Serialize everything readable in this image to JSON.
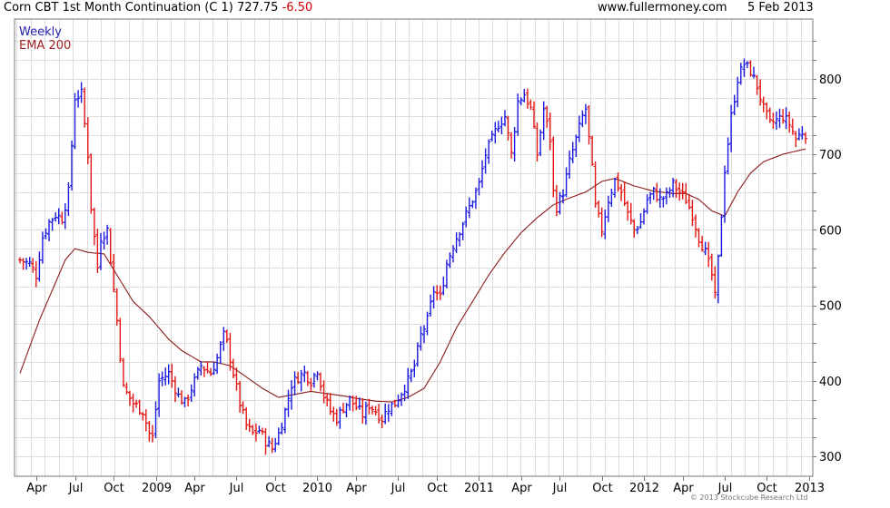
{
  "header": {
    "title": "Corn CBT 1st Month Continuation (C 1) 727.75",
    "change": "-6.50",
    "site": "www.fullermoney.com",
    "date": "5 Feb 2013"
  },
  "legend": {
    "weekly": "Weekly",
    "ema": "EMA 200"
  },
  "copyright": "© 2013 Stockcube Research Ltd",
  "colors": {
    "up": "#1a1adf",
    "down": "#e31414",
    "ema": "#8b1a1a",
    "grid": "#dddddd",
    "frame": "#777777"
  },
  "chart_data": {
    "type": "ohlc",
    "ylim": [
      290,
      860
    ],
    "y_ticks": [
      300,
      400,
      500,
      600,
      700,
      800
    ],
    "x_range": [
      0,
      243
    ],
    "x_ticks": [
      {
        "x": 5,
        "label": "Apr"
      },
      {
        "x": 17,
        "label": "Jul"
      },
      {
        "x": 29,
        "label": "Oct"
      },
      {
        "x": 42,
        "label": "2009"
      },
      {
        "x": 54,
        "label": "Apr"
      },
      {
        "x": 67,
        "label": "Jul"
      },
      {
        "x": 79,
        "label": "Oct"
      },
      {
        "x": 92,
        "label": "2010"
      },
      {
        "x": 104,
        "label": "Apr"
      },
      {
        "x": 117,
        "label": "Jul"
      },
      {
        "x": 129,
        "label": "Oct"
      },
      {
        "x": 142,
        "label": "2011"
      },
      {
        "x": 155,
        "label": "Apr"
      },
      {
        "x": 167,
        "label": "Jul"
      },
      {
        "x": 180,
        "label": "Oct"
      },
      {
        "x": 193,
        "label": "2012"
      },
      {
        "x": 205,
        "label": "Apr"
      },
      {
        "x": 218,
        "label": "Jul"
      },
      {
        "x": 231,
        "label": "Oct"
      },
      {
        "x": 244,
        "label": "2013"
      }
    ],
    "close_anchors": [
      [
        0,
        560
      ],
      [
        3,
        555
      ],
      [
        5,
        540
      ],
      [
        7,
        590
      ],
      [
        9,
        610
      ],
      [
        11,
        620
      ],
      [
        13,
        615
      ],
      [
        15,
        650
      ],
      [
        17,
        775
      ],
      [
        19,
        780
      ],
      [
        21,
        700
      ],
      [
        22,
        630
      ],
      [
        24,
        550
      ],
      [
        25,
        590
      ],
      [
        27,
        600
      ],
      [
        28,
        560
      ],
      [
        30,
        480
      ],
      [
        32,
        390
      ],
      [
        35,
        370
      ],
      [
        38,
        360
      ],
      [
        40,
        330
      ],
      [
        41,
        325
      ],
      [
        43,
        400
      ],
      [
        46,
        410
      ],
      [
        49,
        380
      ],
      [
        51,
        370
      ],
      [
        53,
        390
      ],
      [
        56,
        420
      ],
      [
        59,
        410
      ],
      [
        61,
        430
      ],
      [
        63,
        460
      ],
      [
        64,
        450
      ],
      [
        66,
        410
      ],
      [
        68,
        370
      ],
      [
        70,
        340
      ],
      [
        72,
        330
      ],
      [
        74,
        335
      ],
      [
        76,
        320
      ],
      [
        78,
        310
      ],
      [
        80,
        330
      ],
      [
        82,
        360
      ],
      [
        84,
        395
      ],
      [
        86,
        405
      ],
      [
        88,
        410
      ],
      [
        90,
        400
      ],
      [
        92,
        415
      ],
      [
        94,
        380
      ],
      [
        96,
        360
      ],
      [
        98,
        350
      ],
      [
        100,
        365
      ],
      [
        102,
        375
      ],
      [
        104,
        365
      ],
      [
        106,
        355
      ],
      [
        108,
        368
      ],
      [
        110,
        360
      ],
      [
        112,
        350
      ],
      [
        114,
        365
      ],
      [
        116,
        370
      ],
      [
        118,
        385
      ],
      [
        120,
        400
      ],
      [
        122,
        420
      ],
      [
        124,
        460
      ],
      [
        126,
        480
      ],
      [
        128,
        520
      ],
      [
        130,
        510
      ],
      [
        132,
        555
      ],
      [
        134,
        580
      ],
      [
        136,
        600
      ],
      [
        138,
        620
      ],
      [
        140,
        640
      ],
      [
        142,
        660
      ],
      [
        144,
        700
      ],
      [
        146,
        720
      ],
      [
        148,
        740
      ],
      [
        150,
        750
      ],
      [
        152,
        700
      ],
      [
        154,
        770
      ],
      [
        156,
        780
      ],
      [
        158,
        760
      ],
      [
        160,
        700
      ],
      [
        162,
        760
      ],
      [
        164,
        720
      ],
      [
        165,
        650
      ],
      [
        166,
        630
      ],
      [
        168,
        650
      ],
      [
        170,
        690
      ],
      [
        172,
        720
      ],
      [
        174,
        750
      ],
      [
        175,
        760
      ],
      [
        176,
        720
      ],
      [
        177,
        680
      ],
      [
        178,
        630
      ],
      [
        180,
        600
      ],
      [
        182,
        640
      ],
      [
        184,
        665
      ],
      [
        186,
        650
      ],
      [
        188,
        620
      ],
      [
        190,
        600
      ],
      [
        192,
        610
      ],
      [
        194,
        640
      ],
      [
        196,
        650
      ],
      [
        198,
        640
      ],
      [
        200,
        645
      ],
      [
        202,
        660
      ],
      [
        204,
        650
      ],
      [
        206,
        640
      ],
      [
        208,
        620
      ],
      [
        210,
        590
      ],
      [
        212,
        570
      ],
      [
        214,
        540
      ],
      [
        215,
        510
      ],
      [
        216,
        560
      ],
      [
        218,
        680
      ],
      [
        220,
        750
      ],
      [
        222,
        800
      ],
      [
        224,
        820
      ],
      [
        226,
        810
      ],
      [
        228,
        790
      ],
      [
        230,
        760
      ],
      [
        232,
        740
      ],
      [
        234,
        745
      ],
      [
        236,
        750
      ],
      [
        238,
        740
      ],
      [
        240,
        720
      ],
      [
        242,
        730
      ],
      [
        244,
        725
      ],
      [
        246,
        700
      ],
      [
        247,
        685
      ],
      [
        248,
        700
      ],
      [
        250,
        720
      ],
      [
        252,
        728
      ]
    ],
    "ema_anchors": [
      [
        0,
        410
      ],
      [
        6,
        480
      ],
      [
        10,
        520
      ],
      [
        14,
        560
      ],
      [
        17,
        575
      ],
      [
        21,
        570
      ],
      [
        26,
        568
      ],
      [
        30,
        540
      ],
      [
        35,
        505
      ],
      [
        40,
        485
      ],
      [
        46,
        455
      ],
      [
        50,
        440
      ],
      [
        56,
        425
      ],
      [
        60,
        425
      ],
      [
        65,
        420
      ],
      [
        70,
        405
      ],
      [
        75,
        390
      ],
      [
        80,
        378
      ],
      [
        85,
        382
      ],
      [
        90,
        386
      ],
      [
        95,
        383
      ],
      [
        100,
        380
      ],
      [
        105,
        376
      ],
      [
        110,
        373
      ],
      [
        115,
        372
      ],
      [
        120,
        378
      ],
      [
        125,
        390
      ],
      [
        130,
        425
      ],
      [
        135,
        470
      ],
      [
        140,
        505
      ],
      [
        145,
        540
      ],
      [
        150,
        570
      ],
      [
        155,
        596
      ],
      [
        160,
        616
      ],
      [
        165,
        633
      ],
      [
        170,
        642
      ],
      [
        175,
        650
      ],
      [
        180,
        664
      ],
      [
        184,
        668
      ],
      [
        190,
        658
      ],
      [
        196,
        651
      ],
      [
        202,
        648
      ],
      [
        206,
        648
      ],
      [
        210,
        640
      ],
      [
        214,
        625
      ],
      [
        218,
        618
      ],
      [
        222,
        650
      ],
      [
        226,
        675
      ],
      [
        230,
        690
      ],
      [
        236,
        700
      ],
      [
        242,
        706
      ],
      [
        247,
        710
      ],
      [
        252,
        718
      ]
    ]
  }
}
